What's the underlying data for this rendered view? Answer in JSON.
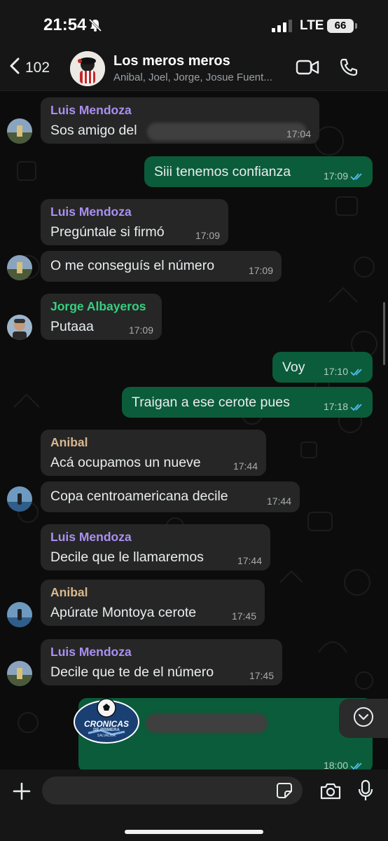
{
  "status_bar": {
    "time": "21:54",
    "network": "LTE",
    "battery": "66"
  },
  "header": {
    "back_count": "102",
    "title": "Los meros meros",
    "members": "Anibal, Joel, Jorge, Josue Fuent..."
  },
  "colors": {
    "outgoing_bubble": "#0b5c3a",
    "incoming_bubble": "#262626",
    "name_purple": "#a990f0",
    "name_green": "#35d07f",
    "name_tan": "#d9b88f",
    "read_ticks": "#53bdeb"
  },
  "messages": [
    {
      "sender": "Luis Mendoza",
      "text": "Sos amigo del",
      "time": "17:04"
    },
    {
      "text": "Siii tenemos confianza",
      "time": "17:09"
    },
    {
      "sender": "Luis Mendoza",
      "text": "Pregúntale si firmó",
      "time": "17:09"
    },
    {
      "text": "O me conseguís el número",
      "time": "17:09"
    },
    {
      "sender": "Jorge Albayeros",
      "text": "Putaaa",
      "time": "17:09"
    },
    {
      "text": "Voy",
      "time": "17:10"
    },
    {
      "text": "Traigan a ese cerote pues",
      "time": "17:18"
    },
    {
      "sender": "Anibal",
      "text": "Acá ocupamos un nueve",
      "time": "17:44"
    },
    {
      "text": "Copa centroamericana decile",
      "time": "17:44"
    },
    {
      "sender": "Luis Mendoza",
      "text": "Decile que le llamaremos",
      "time": "17:44"
    },
    {
      "sender": "Anibal",
      "text": "Apúrate Montoya cerote",
      "time": "17:45"
    },
    {
      "sender": "Luis Mendoza",
      "text": "Decile que te de el número",
      "time": "17:45"
    },
    {
      "time": "18:00",
      "logo": {
        "line1": "CRONICAS",
        "line2": "DE PRIMERA",
        "line3": "SALVADOR"
      }
    }
  ],
  "input": {
    "placeholder": ""
  }
}
